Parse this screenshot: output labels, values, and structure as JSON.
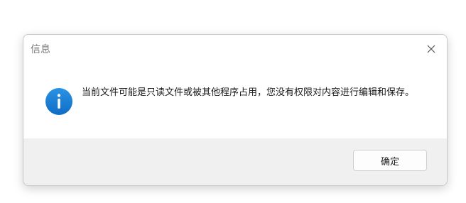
{
  "dialog": {
    "title": "信息",
    "close_icon": "close-icon",
    "icon": "info-icon",
    "accent_color": "#1a7fd6",
    "message": "当前文件可能是只读文件或被其他程序占用，您没有权限对内容进行编辑和保存。",
    "ok_label": "确定"
  }
}
